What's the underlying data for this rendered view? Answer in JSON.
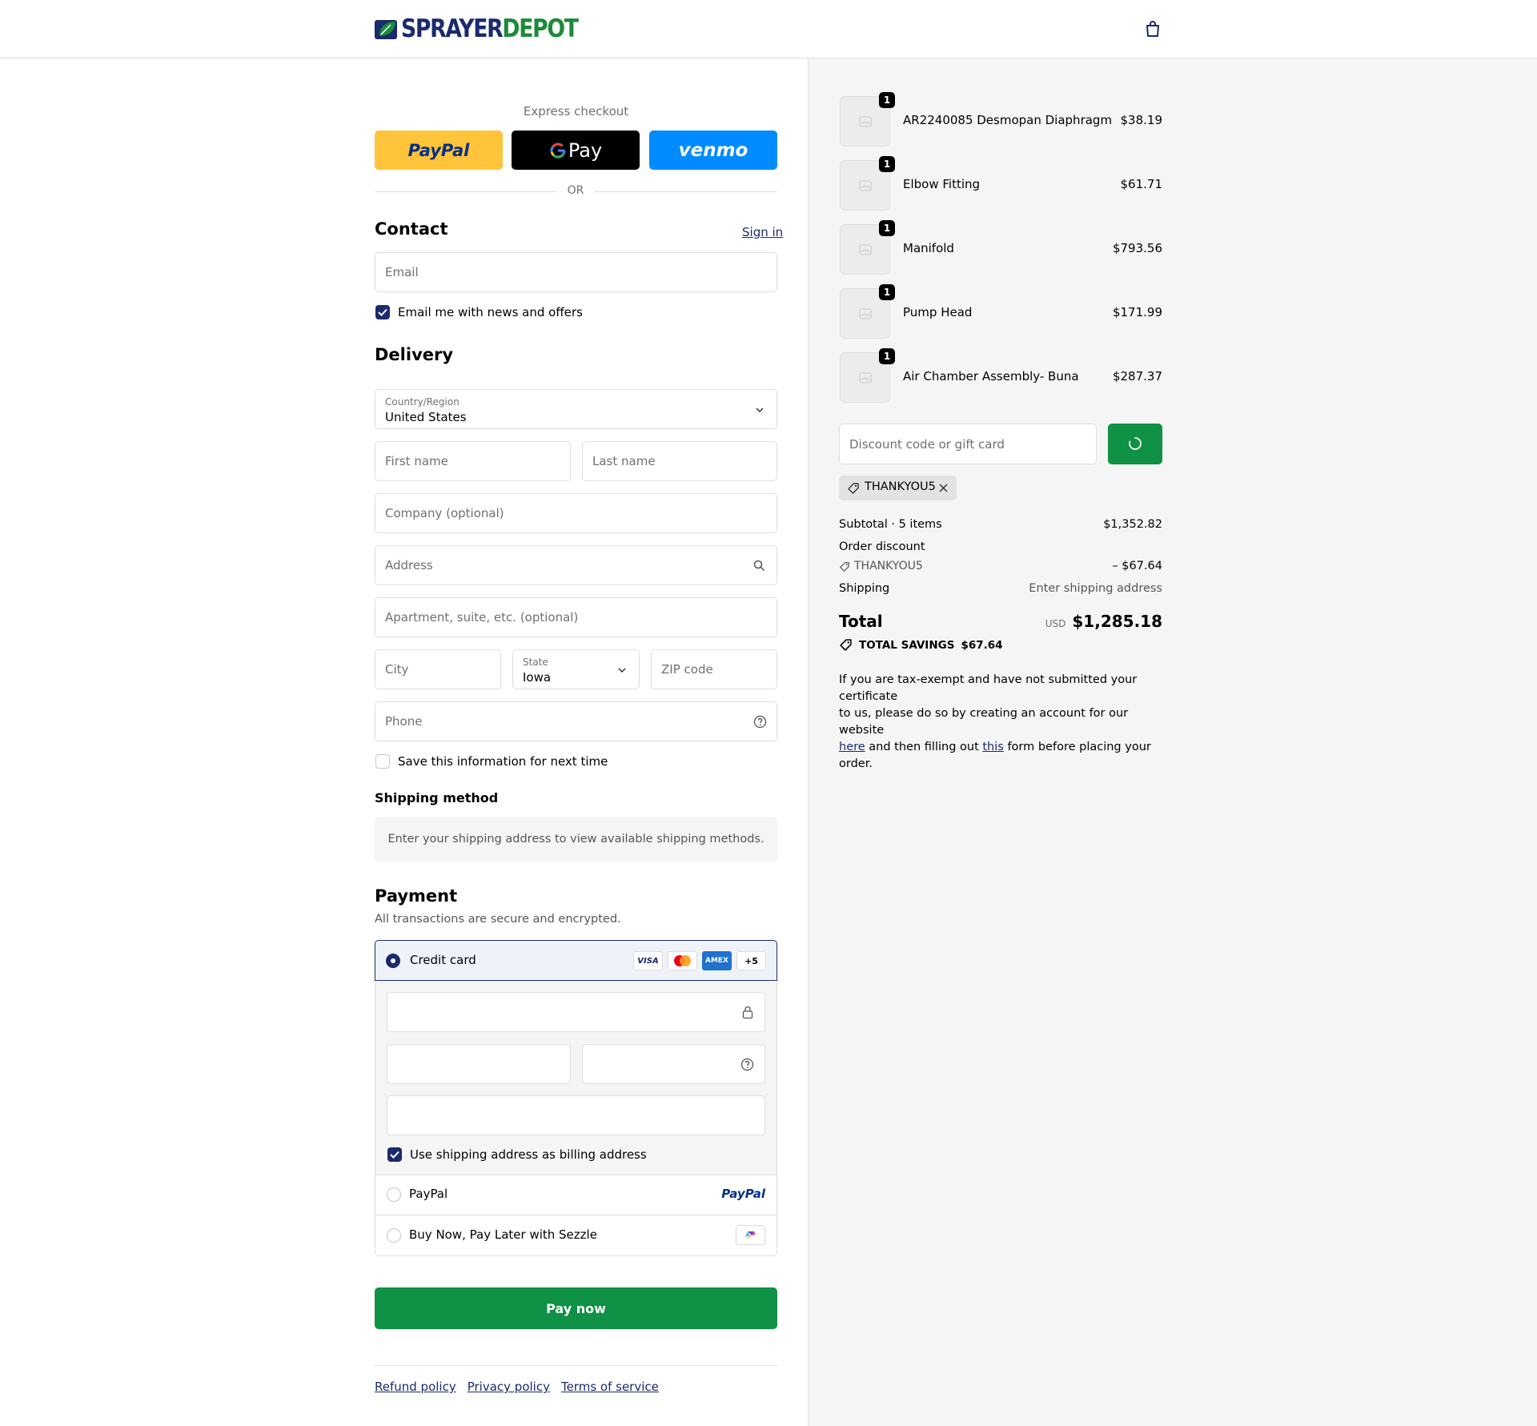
{
  "brand": {
    "name_part1": "SPRAYER",
    "name_part2": "DEPOT"
  },
  "express": {
    "heading": "Express checkout",
    "paypal_label": "PayPal",
    "gpay_label": "Pay",
    "venmo_label": "venmo",
    "or_label": "OR"
  },
  "contact": {
    "heading": "Contact",
    "sign_in": "Sign in",
    "email_placeholder": "Email",
    "news_label": "Email me with news and offers"
  },
  "delivery": {
    "heading": "Delivery",
    "country_label": "Country/Region",
    "country_value": "United States",
    "first_name_placeholder": "First name",
    "last_name_placeholder": "Last name",
    "company_placeholder": "Company (optional)",
    "address_placeholder": "Address",
    "apartment_placeholder": "Apartment, suite, etc. (optional)",
    "city_placeholder": "City",
    "state_label": "State",
    "state_value": "Iowa",
    "zip_placeholder": "ZIP code",
    "phone_placeholder": "Phone",
    "save_label": "Save this information for next time"
  },
  "shipping_method": {
    "heading": "Shipping method",
    "notice": "Enter your shipping address to view available shipping methods."
  },
  "payment": {
    "heading": "Payment",
    "subheading": "All transactions are secure and encrypted.",
    "credit_card_label": "Credit card",
    "card_brands": [
      "VISA",
      "MC",
      "AMEX",
      "+5"
    ],
    "billing_label": "Use shipping address as billing address",
    "paypal_label": "PayPal",
    "paypal_logo": "PayPal",
    "sezzle_label": "Buy Now, Pay Later with Sezzle",
    "pay_button": "Pay now"
  },
  "footer": {
    "refund": "Refund policy",
    "privacy": "Privacy policy",
    "terms": "Terms of service"
  },
  "order": {
    "items": [
      {
        "name": "AR2240085 Desmopan Diaphragm",
        "price": "$38.19",
        "qty": "1"
      },
      {
        "name": "Elbow Fitting",
        "price": "$61.71",
        "qty": "1"
      },
      {
        "name": "Manifold",
        "price": "$793.56",
        "qty": "1"
      },
      {
        "name": "Pump Head",
        "price": "$171.99",
        "qty": "1"
      },
      {
        "name": "Air Chamber Assembly- Buna",
        "price": "$287.37",
        "qty": "1"
      }
    ],
    "discount_placeholder": "Discount code or gift card",
    "applied_code": "THANKYOU5",
    "subtotal_label": "Subtotal · 5 items",
    "subtotal_value": "$1,352.82",
    "order_discount_label": "Order discount",
    "discount_code": "THANKYOU5",
    "discount_value": "– $67.64",
    "shipping_label": "Shipping",
    "shipping_value": "Enter shipping address",
    "total_label": "Total",
    "currency": "USD",
    "total_value": "$1,285.18",
    "savings_label": "TOTAL SAVINGS",
    "savings_value": "$67.64",
    "tax_note_1": "If you are tax-exempt and have not submitted your certificate",
    "tax_note_2": "to us, please do so by creating an account for our website",
    "tax_link_here": "here",
    "tax_note_3": "and then filling out",
    "tax_link_this": "this",
    "tax_note_4": "form before placing your order."
  },
  "colors": {
    "brand_navy": "#1a2a6c",
    "brand_green": "#1b8a3a",
    "pay_button": "#0f9146",
    "paypal_yellow": "#ffc439",
    "venmo_blue": "#008cff"
  }
}
